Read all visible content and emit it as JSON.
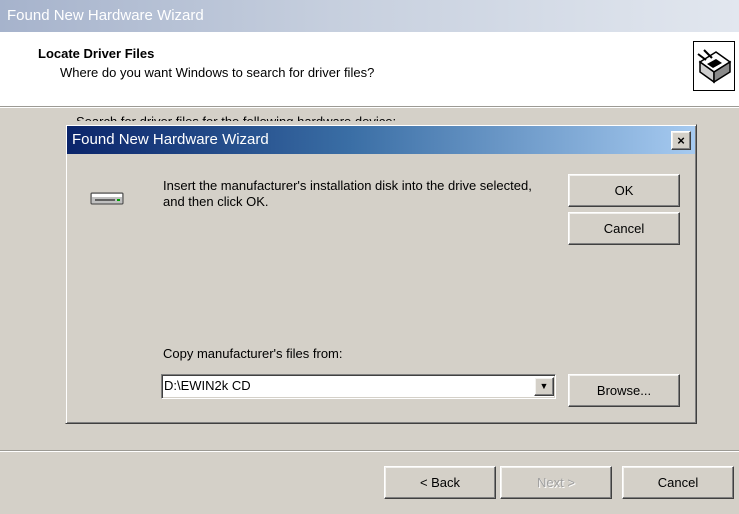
{
  "outer": {
    "title": "Found New Hardware Wizard",
    "heading": "Locate Driver Files",
    "subheading": "Where do you want Windows to search for driver files?",
    "obscured_text": "Search for driver files for the following hardware device:"
  },
  "dialog": {
    "title": "Found New Hardware Wizard",
    "close_glyph": "×",
    "message": "Insert the manufacturer's installation disk into the drive selected, and then click OK.",
    "ok_label": "OK",
    "cancel_label": "Cancel",
    "copy_label": "Copy manufacturer's files from:",
    "path_value": "D:\\EWIN2k CD",
    "dropdown_glyph": "▼",
    "browse_label": "Browse..."
  },
  "footer": {
    "back_label": "< Back",
    "next_label": "Next >",
    "cancel_label": "Cancel",
    "next_disabled": true
  },
  "icons": {
    "wizard": "hardware-wizard-icon",
    "drive": "disk-drive-icon"
  },
  "colors": {
    "dialog_title_start": "#0a246a",
    "dialog_title_end": "#a6caf0",
    "outer_title_inactive": "#a6b3cc",
    "face": "#d4d0c8"
  }
}
